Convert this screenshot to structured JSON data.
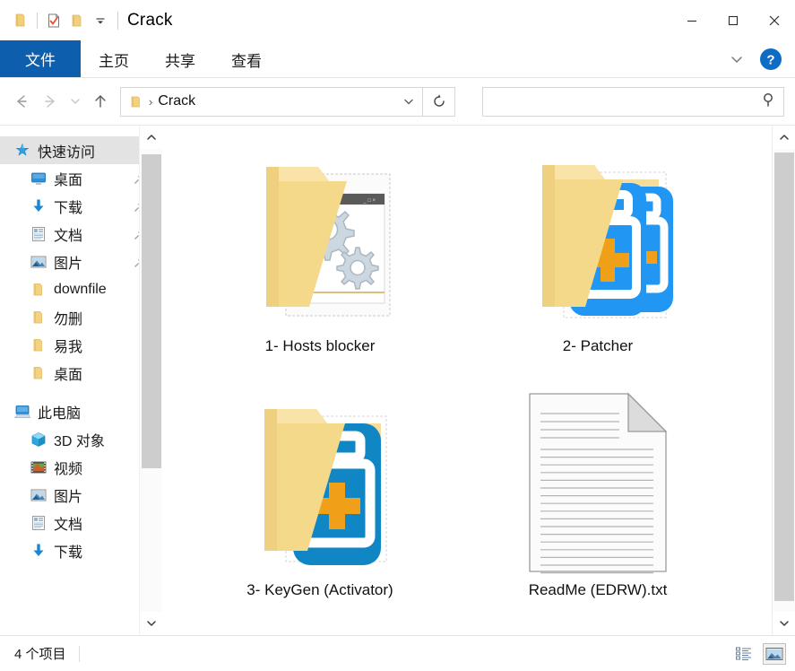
{
  "window": {
    "title": "Crack",
    "quick_access": [
      {
        "name": "folder-icon",
        "label": "文件夹"
      },
      {
        "name": "properties-icon",
        "label": "属性"
      },
      {
        "name": "new-folder-icon",
        "label": "新建文件夹"
      },
      {
        "name": "chevron-down-icon",
        "label": "自定义快速访问工具栏"
      }
    ],
    "controls": {
      "minimize": "—",
      "maximize": "□",
      "close": "✕"
    }
  },
  "ribbon": {
    "tabs": [
      {
        "label": "文件",
        "active": true
      },
      {
        "label": "主页",
        "active": false
      },
      {
        "label": "共享",
        "active": false
      },
      {
        "label": "查看",
        "active": false
      }
    ],
    "collapse_icon": "chevron-down-icon",
    "help_icon": "help-icon",
    "help_label": "?"
  },
  "address": {
    "back_icon": "arrow-left-icon",
    "forward_icon": "arrow-right-icon",
    "recent_icon": "chevron-down-icon",
    "up_icon": "arrow-up-icon",
    "crumb_folder_icon": "folder-icon",
    "crumb_separator": "›",
    "path": "Crack",
    "dropdown_icon": "chevron-down-icon",
    "refresh_icon": "refresh-icon"
  },
  "search": {
    "value": "",
    "placeholder": "",
    "icon": "search-icon"
  },
  "sidebar": {
    "items": [
      {
        "label": "快速访问",
        "icon": "pin-star-icon",
        "depth": 0,
        "selected": true,
        "pinned": false
      },
      {
        "label": "桌面",
        "icon": "desktop-icon",
        "depth": 1,
        "selected": false,
        "pinned": true
      },
      {
        "label": "下载",
        "icon": "download-icon",
        "depth": 1,
        "selected": false,
        "pinned": true
      },
      {
        "label": "文档",
        "icon": "documents-icon",
        "depth": 1,
        "selected": false,
        "pinned": true
      },
      {
        "label": "图片",
        "icon": "pictures-icon",
        "depth": 1,
        "selected": false,
        "pinned": true
      },
      {
        "label": "downfile",
        "icon": "folder-icon",
        "depth": 1,
        "selected": false,
        "pinned": false
      },
      {
        "label": "勿删",
        "icon": "folder-icon",
        "depth": 1,
        "selected": false,
        "pinned": false
      },
      {
        "label": "易我",
        "icon": "folder-icon",
        "depth": 1,
        "selected": false,
        "pinned": false
      },
      {
        "label": "桌面",
        "icon": "folder-icon",
        "depth": 1,
        "selected": false,
        "pinned": false
      },
      {
        "label": "此电脑",
        "icon": "this-pc-icon",
        "depth": 0,
        "selected": false,
        "pinned": false,
        "gap_before": true
      },
      {
        "label": "3D 对象",
        "icon": "3d-objects-icon",
        "depth": 1,
        "selected": false,
        "pinned": false
      },
      {
        "label": "视频",
        "icon": "videos-icon",
        "depth": 1,
        "selected": false,
        "pinned": false
      },
      {
        "label": "图片",
        "icon": "pictures-icon",
        "depth": 1,
        "selected": false,
        "pinned": false
      },
      {
        "label": "文档",
        "icon": "documents-icon",
        "depth": 1,
        "selected": false,
        "pinned": false
      },
      {
        "label": "下载",
        "icon": "download-icon",
        "depth": 1,
        "selected": false,
        "pinned": false
      }
    ],
    "scroll_up_icon": "chevron-up-icon",
    "scroll_down_icon": "chevron-down-icon"
  },
  "files": [
    {
      "label": "1- Hosts blocker",
      "icon": "folder-exe-gears-icon",
      "type": "folder"
    },
    {
      "label": "2- Patcher",
      "icon": "folder-patcher-icon",
      "type": "folder"
    },
    {
      "label": "3- KeyGen (Activator)",
      "icon": "folder-keygen-icon",
      "type": "folder"
    },
    {
      "label": "ReadMe (EDRW).txt",
      "icon": "text-file-icon",
      "type": "file"
    }
  ],
  "statusbar": {
    "item_count": "4 个项目",
    "views": [
      {
        "name": "details-view-button",
        "active": false
      },
      {
        "name": "large-icons-view-button",
        "active": true
      }
    ]
  },
  "content_scroll": {
    "scroll_up_icon": "chevron-up-icon",
    "scroll_down_icon": "chevron-down-icon"
  },
  "colors": {
    "file_tab_blue": "#0d5fad",
    "accent_blue": "#1a7fd4",
    "folder_yellow": "#f5d98b",
    "patcher_blue": "#2196f3",
    "keygen_blue": "#1186c4",
    "plus_orange": "#f0a018"
  }
}
